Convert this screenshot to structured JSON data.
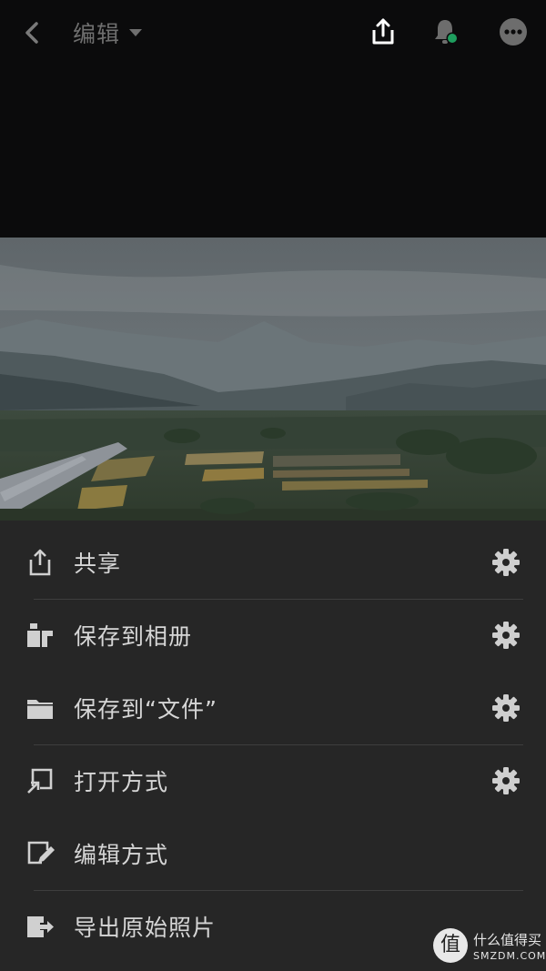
{
  "header": {
    "title": "编辑"
  },
  "menu": {
    "items": [
      {
        "label": "共享",
        "icon": "share-icon",
        "has_settings": true
      },
      {
        "label": "保存到相册",
        "icon": "save-to-album-icon",
        "has_settings": true
      },
      {
        "label": "保存到“文件”",
        "icon": "folder-icon",
        "has_settings": true
      },
      {
        "label": "打开方式",
        "icon": "open-with-icon",
        "has_settings": true
      },
      {
        "label": "编辑方式",
        "icon": "edit-with-icon",
        "has_settings": false
      },
      {
        "label": "导出原始照片",
        "icon": "export-original-icon",
        "has_settings": false
      }
    ]
  },
  "watermark": {
    "logo_char": "值",
    "line1": "什么值得买",
    "line2": "SMZDM.COM"
  },
  "colors": {
    "background": "#0b0b0c",
    "sheet": "#262626",
    "notification_dot": "#1e9e5e"
  }
}
